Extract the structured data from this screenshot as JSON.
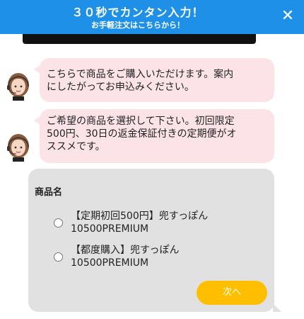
{
  "header": {
    "title": "３０秒でカンタン入力！",
    "subtitle": "お手軽注文はこちらから！",
    "close_label": "✕"
  },
  "messages": [
    {
      "text_line1": "こちらで商品をご購入いただけます。案内",
      "text_line2": "にしたがってお申込みください。"
    },
    {
      "text_line1": "ご希望の商品を選択して下さい。初回限定",
      "text_line2": "500円、30日の返金保証付きの定期便がオ",
      "text_line3": "ススメです。"
    }
  ],
  "product_select": {
    "title": "商品名",
    "options": [
      {
        "line1": "【定期初回500円】兜すっぽん",
        "line2": "10500PREMIUM",
        "selected": false
      },
      {
        "line1": "【都度購入】兜すっぽん",
        "line2": "10500PREMIUM",
        "selected": false
      }
    ],
    "next_label": "次へ"
  },
  "colors": {
    "header_bg": "#1e90e8",
    "bubble_bg": "#fbe3e8",
    "panel_bg": "#e1e1e1",
    "next_button_bg": "#ffbf00"
  },
  "icons": {
    "avatar": "operator-avatar-icon",
    "close": "close-icon"
  }
}
